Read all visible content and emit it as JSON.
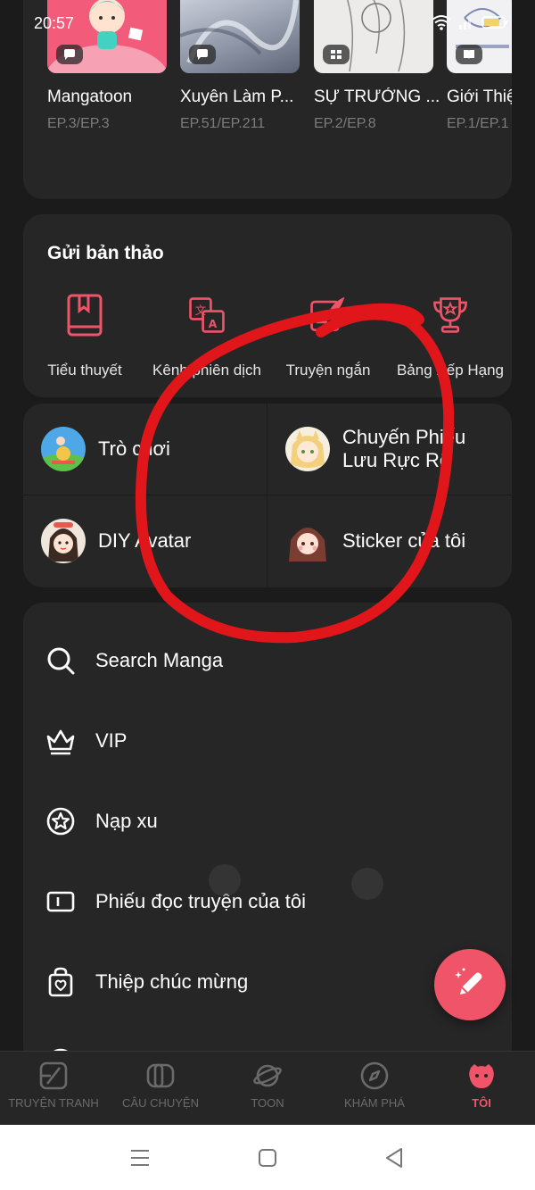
{
  "status": {
    "time": "20:57"
  },
  "recent": [
    {
      "title": "Mangatoon",
      "ep": "EP.3/EP.3"
    },
    {
      "title": "Xuyên Làm P...",
      "ep": "EP.51/EP.211"
    },
    {
      "title": "SỰ TRƯỞNG ...",
      "ep": "EP.2/EP.8"
    },
    {
      "title": "Giới Thiệ",
      "ep": "EP.1/EP.1"
    }
  ],
  "draft": {
    "title": "Gửi bản thảo",
    "items": [
      {
        "label": "Tiểu thuyết",
        "icon": "book-icon"
      },
      {
        "label": "Kênh phiên dịch",
        "icon": "translate-icon"
      },
      {
        "label": "Truyện ngắn",
        "icon": "quill-icon"
      },
      {
        "label": "Bảng Xếp Hạng",
        "icon": "trophy-icon"
      }
    ]
  },
  "features": [
    {
      "label": "Trò chơi"
    },
    {
      "label_line1": "Chuyến Phiếu",
      "label_line2": "Lưu Rực Rỡ"
    },
    {
      "label": "DIY Avatar"
    },
    {
      "label": "Sticker của tôi"
    }
  ],
  "menu": [
    {
      "label": "Search Manga",
      "icon": "search-icon"
    },
    {
      "label": "VIP",
      "icon": "crown-icon"
    },
    {
      "label": "Nạp xu",
      "icon": "star-coin-icon"
    },
    {
      "label": "Phiếu đọc truyện của tôi",
      "icon": "ticket-icon"
    },
    {
      "label": "Thiệp chúc mừng",
      "icon": "gift-bag-icon"
    }
  ],
  "nav": [
    {
      "label": "TRUYỆN TRANH"
    },
    {
      "label": "CÂU CHUYỆN"
    },
    {
      "label": "TOON"
    },
    {
      "label": "KHÁM PHÁ"
    },
    {
      "label": "TÔI"
    }
  ],
  "colors": {
    "accent": "#f05468",
    "background": "#1b1b1b",
    "card": "#262626",
    "annotation": "#e0161b"
  }
}
